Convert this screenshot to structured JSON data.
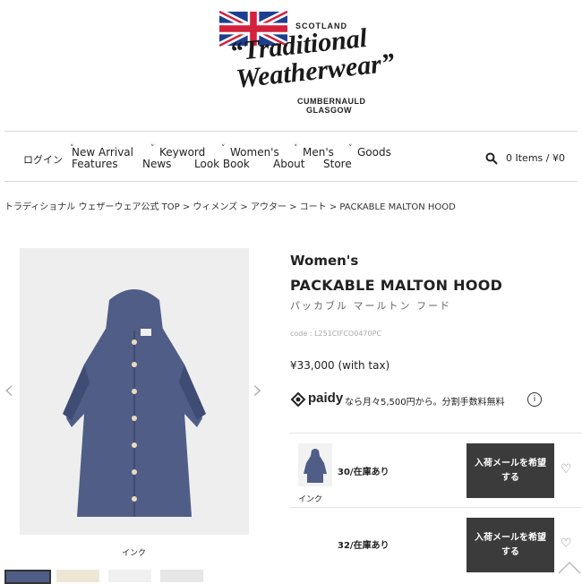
{
  "brand": {
    "line1": "SCOTLAND",
    "script1": "“Traditional",
    "script2": "Weatherwear”",
    "city1": "CUMBERNAULD",
    "city2": "GLASGOW"
  },
  "nav": {
    "login": "ログイン",
    "items": [
      {
        "top": "New Arrival",
        "bottom": "Features"
      },
      {
        "top": "Keyword",
        "bottom": "News"
      },
      {
        "top": "Women's",
        "bottom": "Look Book"
      },
      {
        "top": "Men's",
        "bottom": "About"
      },
      {
        "top": "Goods",
        "bottom": "Store"
      }
    ],
    "cart": "0 Items / ¥0"
  },
  "breadcrumb": "トラディショナル ウェザーウェア公式 TOP > ウィメンズ > アウター > コート > PACKABLE MALTON HOOD",
  "product": {
    "category": "Women's",
    "name": "PACKABLE MALTON HOOD",
    "kana": "パッカブル マールトン フード",
    "code": "code : L251CIFCO0470PC",
    "price": "¥33,000 (with tax)",
    "paidy_brand": "paidy",
    "paidy_text": "なら月々5,500円から。分割手数料無料",
    "image_caption": "インク",
    "colors": {
      "coat": "#4f5d87",
      "coat_dark": "#3f4c74",
      "button": "#e8dcc0"
    }
  },
  "skus": [
    {
      "color": "インク",
      "size": "30/在庫あり",
      "button": [
        "入荷メールを希望",
        "する"
      ]
    },
    {
      "color": "",
      "size": "32/在庫あり",
      "button": [
        "入荷メールを希望",
        "する"
      ]
    }
  ]
}
